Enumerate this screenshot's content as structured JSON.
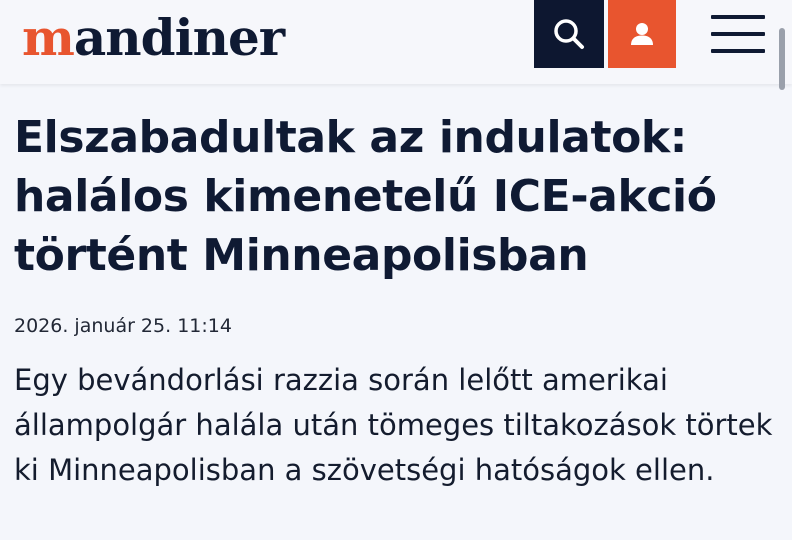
{
  "header": {
    "logo_first": "m",
    "logo_rest": "andiner",
    "search_icon": "search-icon",
    "user_icon": "user-icon",
    "menu_icon": "hamburger-menu-icon",
    "colors": {
      "brand_accent": "#e8552f",
      "brand_dark": "#0d1730"
    }
  },
  "article": {
    "title": "Elszabadultak az indulatok: halálos kimenetelű ICE-akció történt Minneapolisban",
    "date": "2026. január 25. 11:14",
    "lead": "Egy bevándorlási razzia során lelőtt amerikai állampolgár halála után tömeges tiltakozások törtek ki Minneapolisban a szövetségi hatóságok ellen."
  }
}
